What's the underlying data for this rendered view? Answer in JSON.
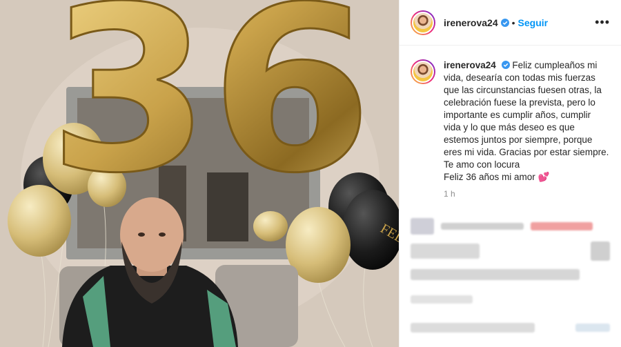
{
  "header": {
    "username": "irenerova24",
    "separator": "•",
    "follow_label": "Seguir",
    "more_icon": "more-icon"
  },
  "caption": {
    "username": "irenerova24",
    "lines": [
      "Feliz cumpleaños mi",
      "vida, desearía con todas mis fuerzas",
      "que las circunstancias fuesen otras, la",
      "celebración fuese la prevista, pero lo",
      "importante es cumplir años, cumplir",
      "vida y lo que más deseo es que",
      "estemos juntos por siempre, porque",
      "eres mi vida. Gracias por estar siempre.",
      "Te amo con locura",
      "Feliz 36 años mi amor 💕"
    ],
    "time": "1 h"
  },
  "photo": {
    "balloon_numbers": "36",
    "balloon_text": "FEL"
  },
  "colors": {
    "accent": "#0095f6",
    "gold": "#c9a24a",
    "muted": "#8e8e8e"
  }
}
